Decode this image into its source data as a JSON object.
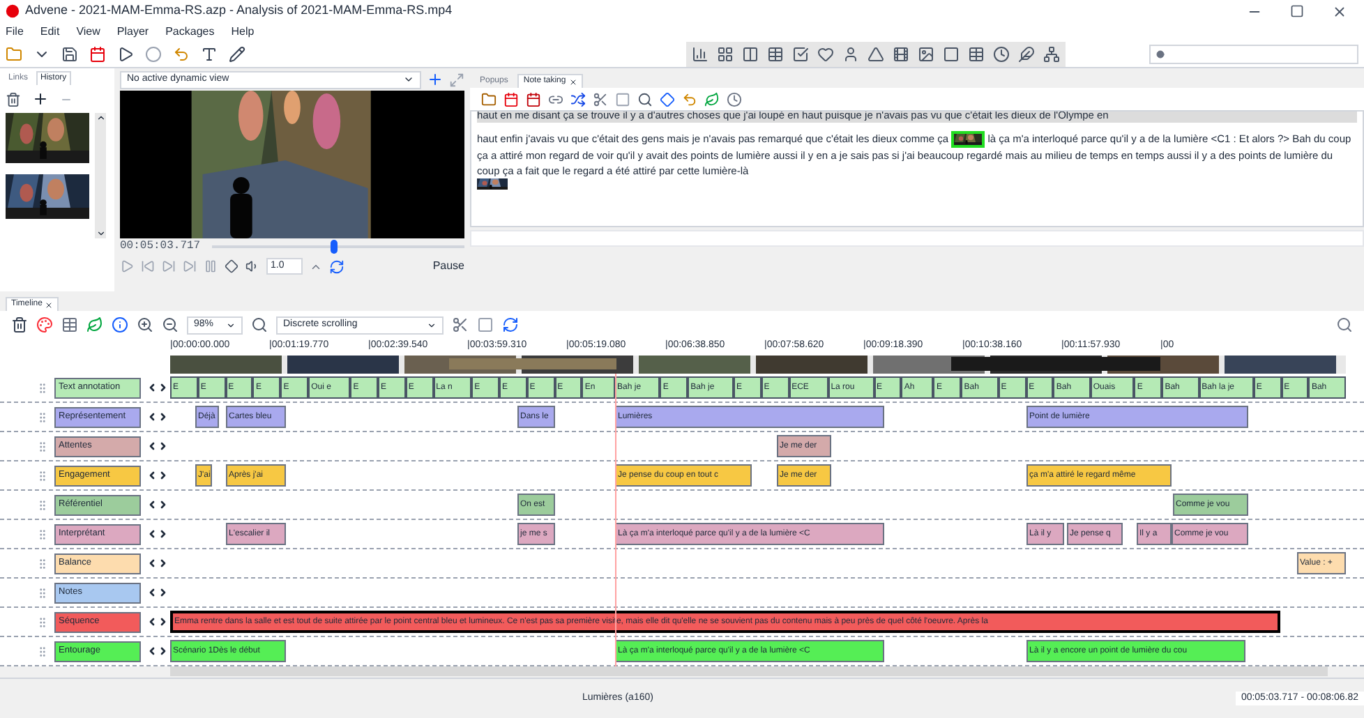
{
  "window": {
    "title": "Advene - 2021-MAM-Emma-RS.azp - Analysis of 2021-MAM-Emma-RS.mp4"
  },
  "menu": [
    "File",
    "Edit",
    "View",
    "Player",
    "Packages",
    "Help"
  ],
  "left_panel": {
    "tabs": [
      {
        "label": "Links",
        "selected": false
      },
      {
        "label": "History",
        "selected": true
      }
    ]
  },
  "player": {
    "view_select": "No active dynamic view",
    "time": "00:05:03.717",
    "level": 0.47,
    "rate": "1.0",
    "state": "Pause"
  },
  "note_panel": {
    "tabs": [
      {
        "label": "Popups",
        "selected": false
      },
      {
        "label": "Note taking",
        "selected": true
      }
    ],
    "cut_line": "haut en me disant ça se trouve il y a d'autres choses que j'ai loupé en haut puisque je n'avais pas vu que c'était les dieux de l'Olympe en",
    "text_before": "haut enfin j'avais vu que c'était des gens mais je n'avais pas remarqué que c'était les dieux comme ça",
    "text_after": "là ça m'a interloqué parce qu'il y a de la lumière <C1 : Et alors ?> Bah du coup ça a attiré mon regard de voir qu'il y avait des points de lumière aussi il y en a je sais pas si j'ai beaucoup regardé mais au milieu de temps en temps aussi il y a des points de lumière du coup ça a fait que le regard a été attiré par cette lumière-là"
  },
  "timeline": {
    "tab": "Timeline",
    "zoom": "98%",
    "scrolling": "Discrete scrolling",
    "ticks": [
      "|00:00:00.000",
      "|00:01:19.770",
      "|00:02:39.540",
      "|00:03:59.310",
      "|00:05:19.080",
      "|00:06:38.850",
      "|00:07:58.620",
      "|00:09:18.390",
      "|00:10:38.160",
      "|00:11:57.930",
      "|00"
    ],
    "rows": [
      {
        "label": "Text annotation",
        "color": "#b5eab5",
        "annotations": [
          {
            "text": "E"
          },
          {
            "text": "E"
          },
          {
            "text": "E"
          },
          {
            "text": "E"
          },
          {
            "text": "E"
          },
          {
            "text": "Oui e"
          },
          {
            "text": "E"
          },
          {
            "text": "E"
          },
          {
            "text": "E"
          },
          {
            "text": "La n"
          },
          {
            "text": "E"
          },
          {
            "text": "E"
          },
          {
            "text": "E"
          },
          {
            "text": "E"
          },
          {
            "text": "En"
          },
          {
            "text": "Bah je"
          },
          {
            "text": "E"
          },
          {
            "text": "Bah je"
          },
          {
            "text": "E"
          },
          {
            "text": "E"
          },
          {
            "text": "ECE"
          },
          {
            "text": "La rou"
          },
          {
            "text": "E"
          },
          {
            "text": "Ah"
          },
          {
            "text": "E"
          },
          {
            "text": "Bah"
          },
          {
            "text": "E"
          },
          {
            "text": "E"
          },
          {
            "text": "Bah"
          },
          {
            "text": "Ouais"
          },
          {
            "text": "E"
          },
          {
            "text": "Bah"
          },
          {
            "text": "Bah la je"
          },
          {
            "text": "E"
          },
          {
            "text": "E"
          },
          {
            "text": "Bah"
          }
        ]
      },
      {
        "label": "Représentement",
        "color": "#a9a9ee",
        "annotations": [
          {
            "text": "Déjà"
          },
          {
            "text": "Cartes bleu"
          },
          {
            "text": "Dans le"
          },
          {
            "text": "Lumières"
          },
          {
            "text": "Point de lumière"
          }
        ]
      },
      {
        "label": "Attentes",
        "color": "#d4aaaa",
        "annotations": [
          {
            "text": "Je me der"
          }
        ]
      },
      {
        "label": "Engagement",
        "color": "#f7c843",
        "annotations": [
          {
            "text": "J'ai"
          },
          {
            "text": "Après j'ai"
          },
          {
            "text": "Je pense du coup en tout c"
          },
          {
            "text": "Je me der"
          },
          {
            "text": "ça m'a attiré le regard même"
          }
        ]
      },
      {
        "label": "Référentiel",
        "color": "#9ccc9c",
        "annotations": [
          {
            "text": "On est"
          },
          {
            "text": "Comme je vou"
          }
        ]
      },
      {
        "label": "Interprétant",
        "color": "#dca8c0",
        "annotations": [
          {
            "text": "L'escalier il"
          },
          {
            "text": "je me s"
          },
          {
            "text": "Là ça m'a interloqué parce qu'il y a de la lumière <C"
          },
          {
            "text": "Là il y"
          },
          {
            "text": "Je pense q"
          },
          {
            "text": "Il y a"
          },
          {
            "text": "Comme je vou"
          }
        ]
      },
      {
        "label": "Balance",
        "color": "#fddcae",
        "annotations": [
          {
            "text": "Value : +"
          }
        ]
      },
      {
        "label": "Notes",
        "color": "#a8c8f0",
        "annotations": []
      },
      {
        "label": "Séquence",
        "color": "#f25b5b",
        "annotations": [
          {
            "text": "Emma rentre dans la salle et est tout de suite attirée par le point central bleu et lumineux. Ce n'est pas sa première visite, mais elle dit qu'elle ne se souvient pas du contenu mais à peu près de quel côté l'oeuvre. Après la"
          }
        ]
      },
      {
        "label": "Entourage",
        "color": "#55ee55",
        "annotations": [
          {
            "text": "Scénario 1Dès le début"
          },
          {
            "text": "Là ça m'a interloqué parce qu'il y a de la lumière <C"
          },
          {
            "text": "Là il y a encore un point de lumière du cou"
          }
        ]
      }
    ]
  },
  "status": {
    "selection": "Lumières (a160)",
    "range": "00:05:03.717 - 00:08:06.82"
  }
}
